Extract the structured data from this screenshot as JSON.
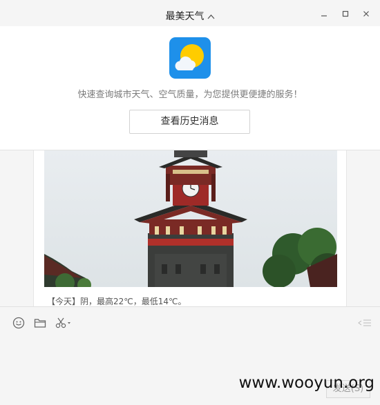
{
  "window": {
    "title": "最美天气",
    "title_chevron_icon": "chevron-up-icon",
    "controls": [
      "minimize-icon",
      "maximize-icon",
      "close-icon"
    ]
  },
  "header": {
    "app_icon": "sun-cloud-weather-icon",
    "description": "快速查询城市天气、空气质量，为您提供更便捷的服务！",
    "history_button_label": "查看历史消息"
  },
  "message": {
    "image_subject": "clock-tower-photo",
    "text": "【今天】阴，最高22℃，最低14℃。"
  },
  "composer": {
    "tools": [
      "emoji-icon",
      "folder-icon",
      "scissors-icon"
    ],
    "send_label": "发送(S)",
    "watermark": "www.wooyun.org"
  },
  "colors": {
    "app_icon_bg": "#1e90ea",
    "sun": "#ffcc00"
  }
}
